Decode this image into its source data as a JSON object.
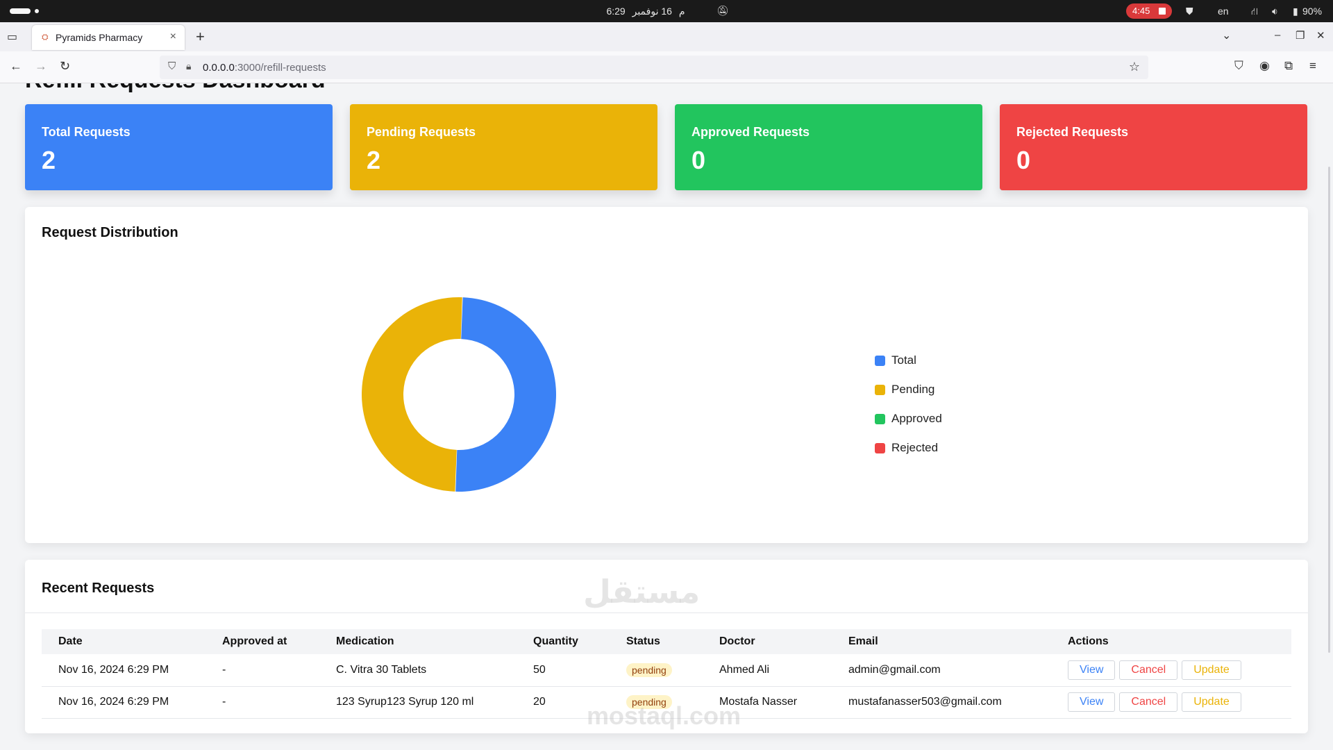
{
  "os": {
    "time": "6:29 م",
    "date": "16 نوفمبر",
    "rec_time": "4:45",
    "lang": "en",
    "battery": "90%"
  },
  "browser": {
    "tab_title": "Pyramids Pharmacy",
    "url_host": "0.0.0.0",
    "url_path": ":3000/refill-requests"
  },
  "page": {
    "title": "Refill Requests Dashboard"
  },
  "stats": [
    {
      "label": "Total Requests",
      "value": "2",
      "color": "#3b82f6"
    },
    {
      "label": "Pending Requests",
      "value": "2",
      "color": "#eab308"
    },
    {
      "label": "Approved Requests",
      "value": "0",
      "color": "#22c55e"
    },
    {
      "label": "Rejected Requests",
      "value": "0",
      "color": "#ef4444"
    }
  ],
  "distribution": {
    "title": "Request Distribution",
    "legend": [
      {
        "label": "Total",
        "color": "#3b82f6"
      },
      {
        "label": "Pending",
        "color": "#eab308"
      },
      {
        "label": "Approved",
        "color": "#22c55e"
      },
      {
        "label": "Rejected",
        "color": "#ef4444"
      }
    ]
  },
  "chart_data": {
    "type": "pie",
    "categories": [
      "Total",
      "Pending",
      "Approved",
      "Rejected"
    ],
    "values": [
      2,
      2,
      0,
      0
    ],
    "colors": [
      "#3b82f6",
      "#eab308",
      "#22c55e",
      "#ef4444"
    ],
    "title": "Request Distribution",
    "legend_position": "right"
  },
  "recent": {
    "title": "Recent Requests",
    "columns": [
      "Date",
      "Approved at",
      "Medication",
      "Quantity",
      "Status",
      "Doctor",
      "Email",
      "Actions"
    ],
    "rows": [
      {
        "date": "Nov 16, 2024 6:29 PM",
        "approved_at": "-",
        "medication": "C. Vitra 30 Tablets",
        "quantity": "50",
        "status": "pending",
        "doctor": "Ahmed Ali",
        "email": "admin@gmail.com"
      },
      {
        "date": "Nov 16, 2024 6:29 PM",
        "approved_at": "-",
        "medication": "123 Syrup123 Syrup 120 ml",
        "quantity": "20",
        "status": "pending",
        "doctor": "Mostafa Nasser",
        "email": "mustafanasser503@gmail.com"
      }
    ],
    "actions": {
      "view": "View",
      "cancel": "Cancel",
      "update": "Update"
    }
  },
  "watermark": {
    "arabic": "مستقل",
    "latin": "mostaql.com"
  }
}
